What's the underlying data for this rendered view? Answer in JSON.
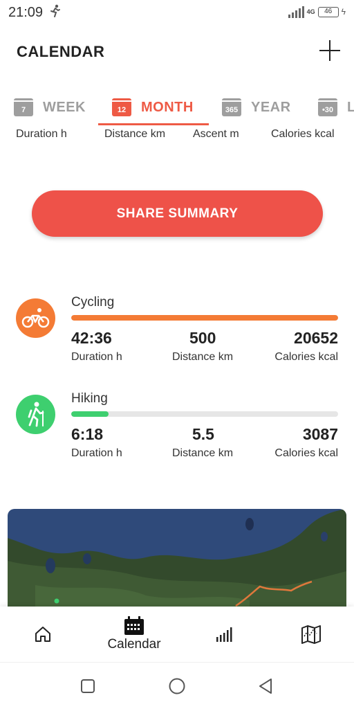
{
  "status_bar": {
    "time": "21:09",
    "network": "4G",
    "battery": "46"
  },
  "header": {
    "title": "CALENDAR"
  },
  "tabs": [
    {
      "label": "WEEK",
      "icon_num": "7"
    },
    {
      "label": "MONTH",
      "icon_num": "12"
    },
    {
      "label": "YEAR",
      "icon_num": "365"
    },
    {
      "label": "L",
      "icon_num": "•30"
    }
  ],
  "summary_labels": {
    "duration": "Duration h",
    "distance": "Distance km",
    "ascent": "Ascent m",
    "calories": "Calories kcal"
  },
  "share_button": {
    "label": "SHARE SUMMARY"
  },
  "activities": [
    {
      "name": "Cycling",
      "color": "#f47b35",
      "progress": 1.0,
      "duration": "42:36",
      "duration_label": "Duration h",
      "distance": "500",
      "distance_label": "Distance km",
      "calories": "20652",
      "calories_label": "Calories kcal"
    },
    {
      "name": "Hiking",
      "color": "#3ecf6f",
      "progress": 0.14,
      "duration": "6:18",
      "duration_label": "Duration h",
      "distance": "5.5",
      "distance_label": "Distance km",
      "calories": "3087",
      "calories_label": "Calories kcal"
    }
  ],
  "bottom_nav": {
    "home_icon": "home-icon",
    "calendar_label": "Calendar",
    "stats_icon": "bar-chart-icon",
    "map_icon": "map-icon"
  },
  "colors": {
    "accent": "#ee5a45",
    "cycling": "#f47b35",
    "hiking": "#3ecf6f"
  }
}
